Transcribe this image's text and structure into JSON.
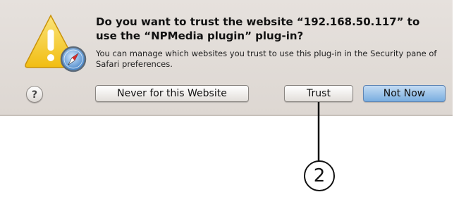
{
  "dialog": {
    "title": "Do you want to trust the website “192.168.50.117” to use the “NPMedia plugin” plug-in?",
    "body": "You can manage which websites you trust to use this plug-in in the Security pane of Safari preferences.",
    "icon": "warning-safari-icon",
    "help_label": "?",
    "buttons": {
      "never": "Never for this Website",
      "trust": "Trust",
      "not_now": "Not Now"
    }
  },
  "callout": {
    "number": "2",
    "target": "trust-button"
  },
  "colors": {
    "dialog_background": "#e0dbd6",
    "default_button": "#8db8e6",
    "warning_yellow": "#f5c518"
  }
}
